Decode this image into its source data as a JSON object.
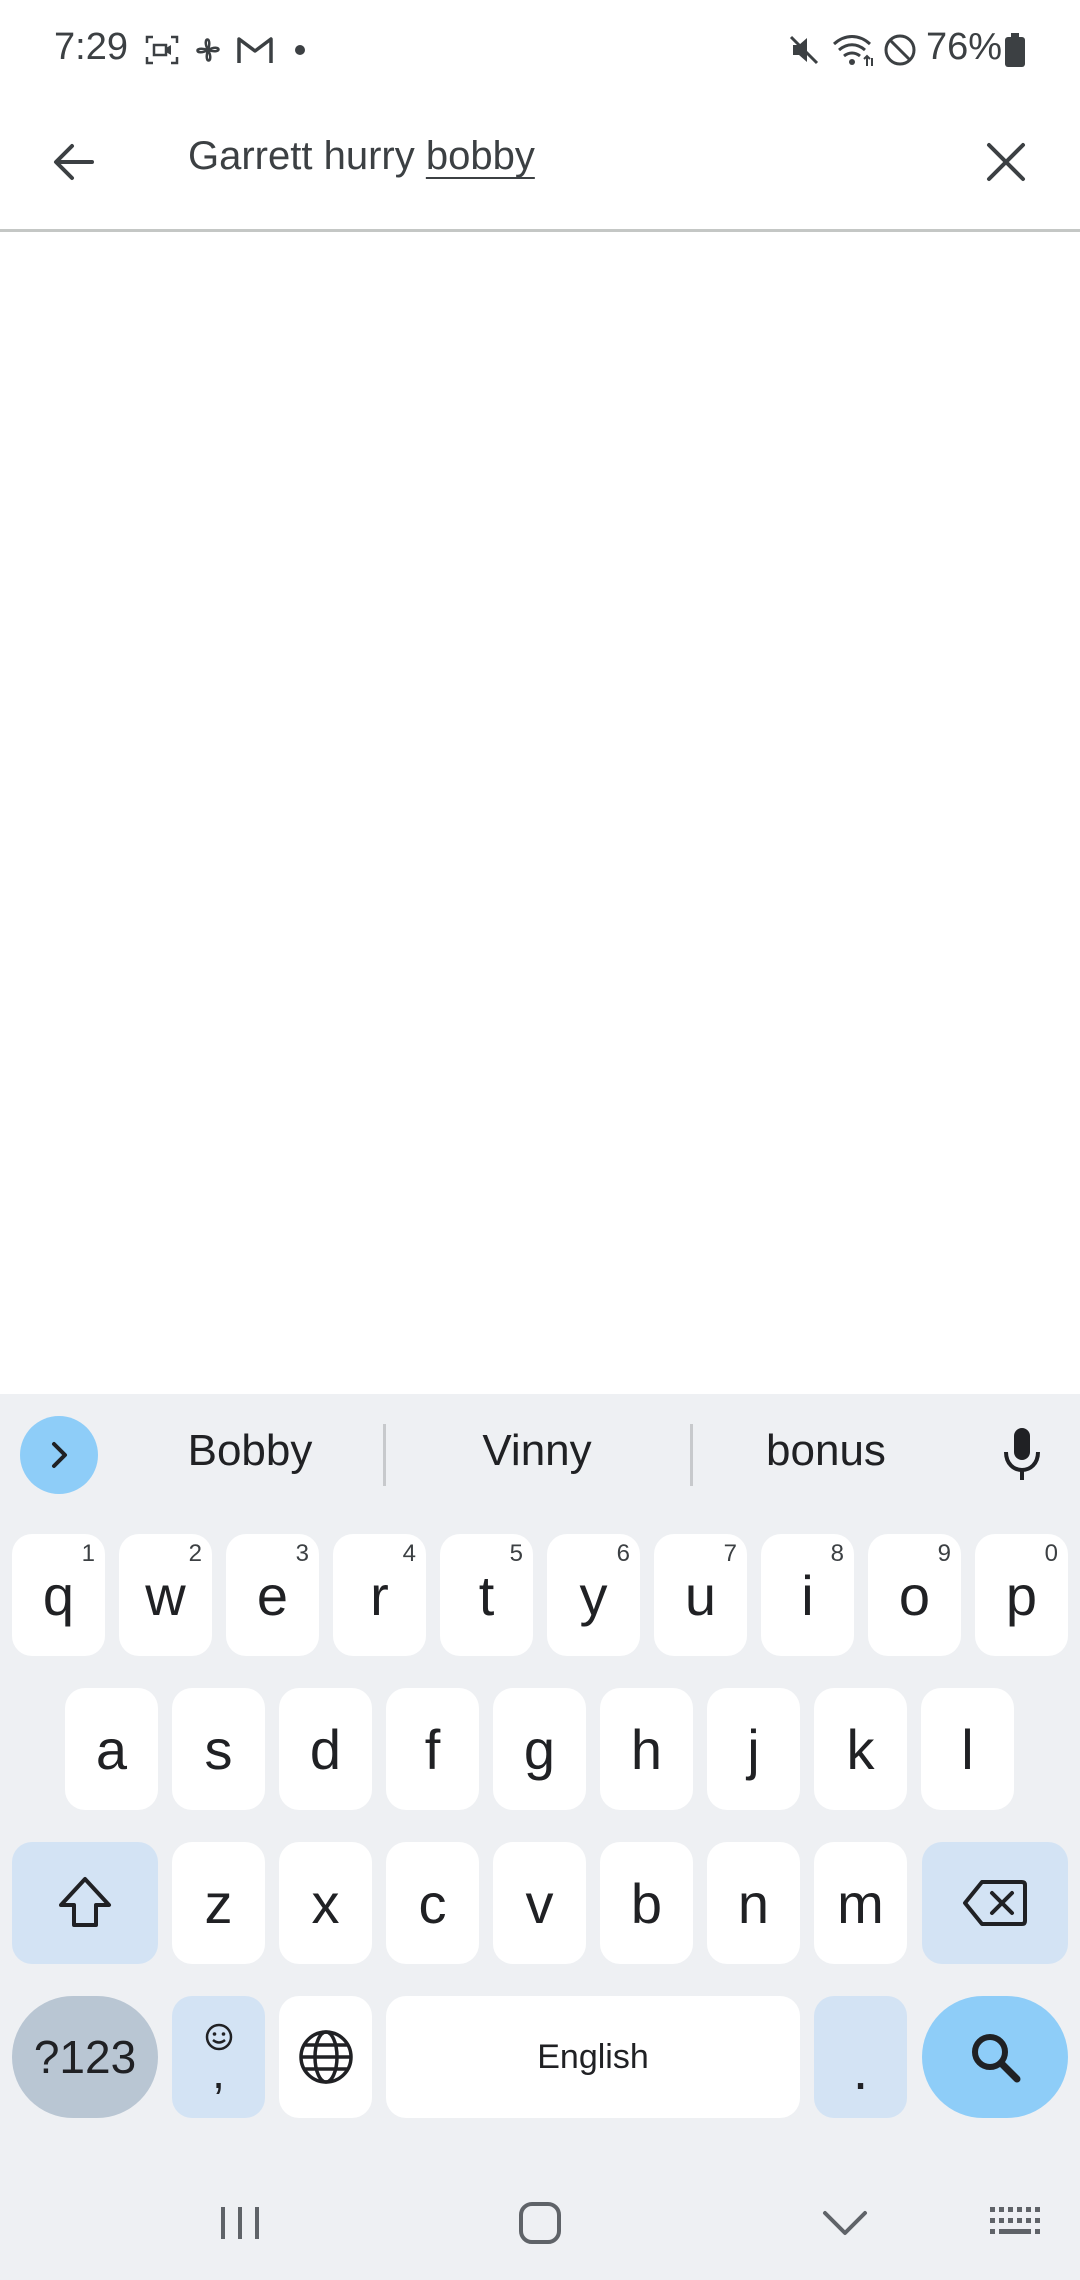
{
  "status_bar": {
    "time": "7:29",
    "battery_percent": "76%",
    "left_icons": [
      "screen-record-icon",
      "fan-icon",
      "gmail-icon",
      "notification-dot-icon"
    ],
    "right_icons": [
      "mute-icon",
      "wifi-icon",
      "do-not-disturb-icon",
      "battery-icon"
    ]
  },
  "search": {
    "text_plain": "Garrett hurry ",
    "text_composing": "bobby",
    "back_icon": "arrow-left-icon",
    "clear_icon": "close-icon"
  },
  "keyboard": {
    "suggestions": [
      "Bobby",
      "Vinny",
      "bonus"
    ],
    "row1": [
      {
        "label": "q",
        "hint": "1"
      },
      {
        "label": "w",
        "hint": "2"
      },
      {
        "label": "e",
        "hint": "3"
      },
      {
        "label": "r",
        "hint": "4"
      },
      {
        "label": "t",
        "hint": "5"
      },
      {
        "label": "y",
        "hint": "6"
      },
      {
        "label": "u",
        "hint": "7"
      },
      {
        "label": "i",
        "hint": "8"
      },
      {
        "label": "o",
        "hint": "9"
      },
      {
        "label": "p",
        "hint": "0"
      }
    ],
    "row2": [
      "a",
      "s",
      "d",
      "f",
      "g",
      "h",
      "j",
      "k",
      "l"
    ],
    "row3": [
      "z",
      "x",
      "c",
      "v",
      "b",
      "n",
      "m"
    ],
    "symbols_label": "?123",
    "comma_label": ",",
    "space_label": "English",
    "period_label": ".",
    "colors": {
      "accent": "#8ecdf8",
      "func_key": "#d3e3f4",
      "background": "#eef0f3"
    }
  },
  "nav_bar": {
    "icons": [
      "recent-apps-icon",
      "home-icon",
      "hide-keyboard-icon",
      "keyboard-switch-icon"
    ]
  }
}
